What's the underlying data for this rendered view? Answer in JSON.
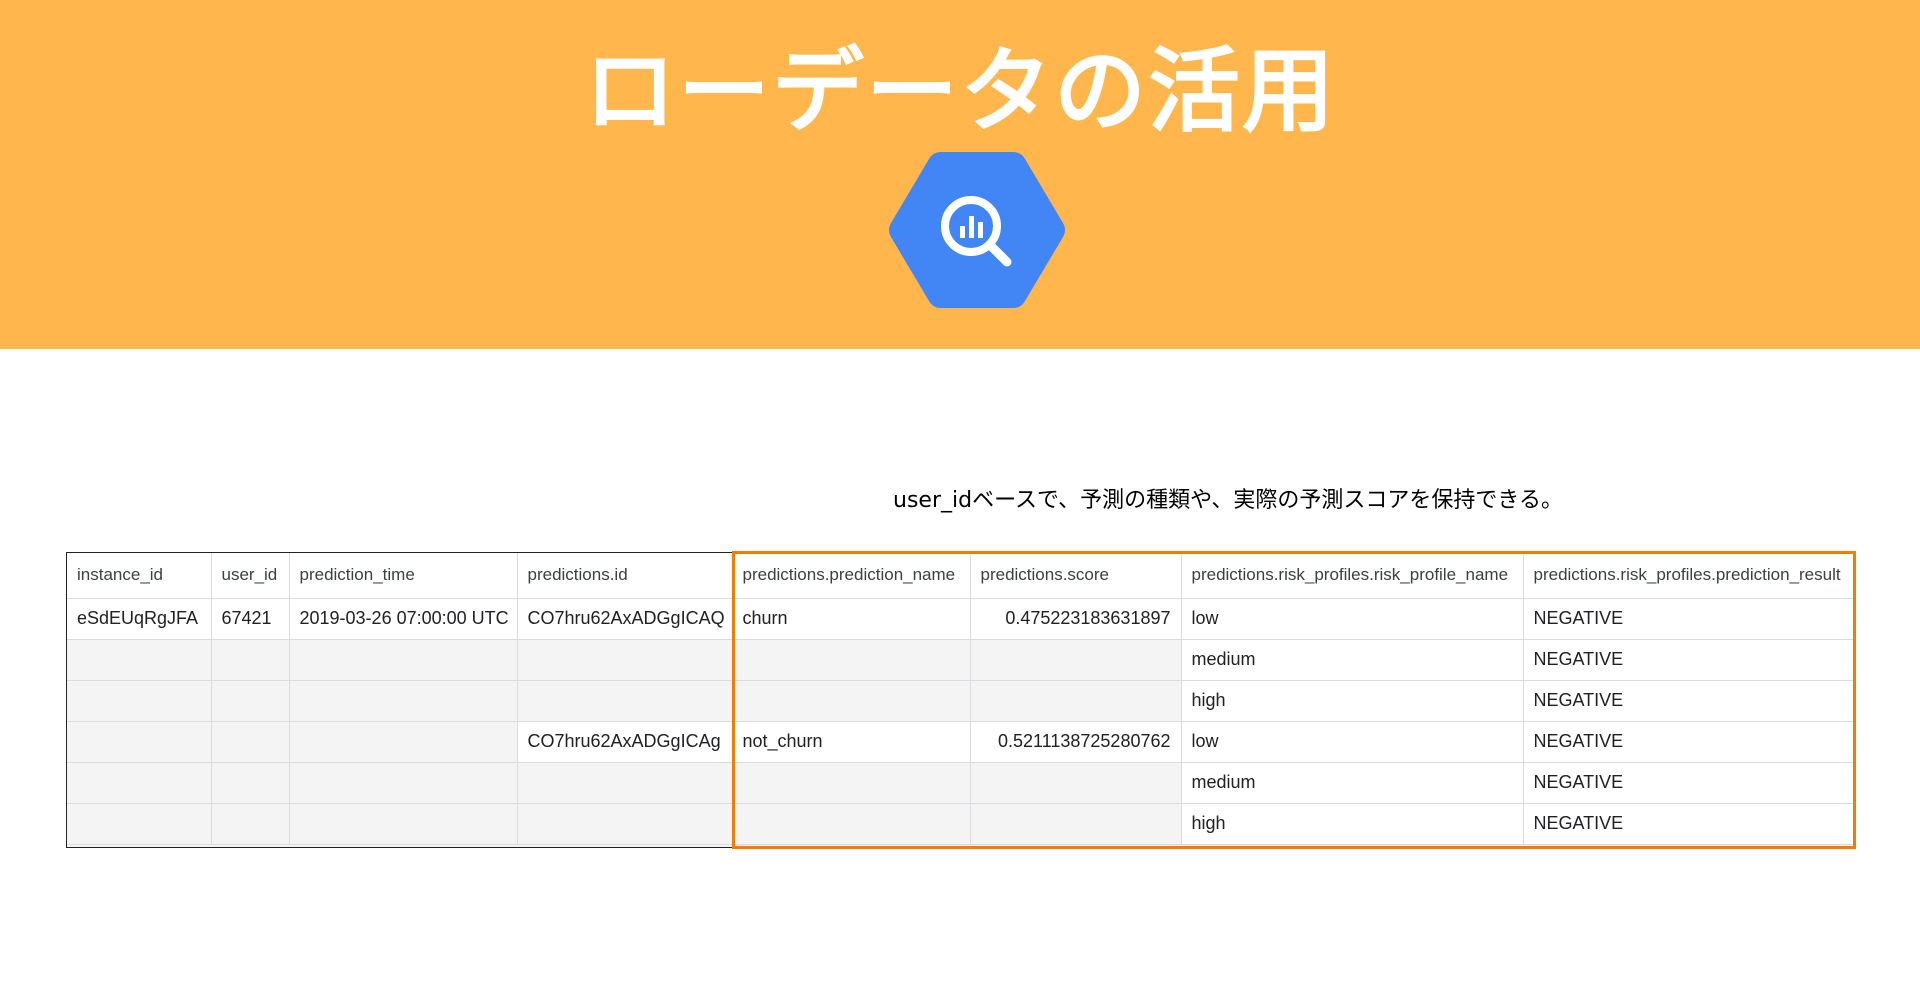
{
  "header": {
    "title": "ローデータの活用",
    "logo_icon": "bigquery-logo-icon",
    "banner_color": "#FFB74D",
    "logo_color": "#4285F4"
  },
  "caption": "user_idベースで、予測の種類や、実際の予測スコアを保持できる。",
  "highlight_color": "#F57C00",
  "table": {
    "columns": [
      "instance_id",
      "user_id",
      "prediction_time",
      "predictions.id",
      "predictions.prediction_name",
      "predictions.score",
      "predictions.risk_profiles.risk_profile_name",
      "predictions.risk_profiles.prediction_result"
    ],
    "rows": [
      [
        "eSdEUqRgJFA",
        "67421",
        "2019-03-26 07:00:00 UTC",
        "CO7hru62AxADGgICAQ",
        "churn",
        "0.475223183631897",
        "low",
        "NEGATIVE"
      ],
      [
        "",
        "",
        "",
        "",
        "",
        "",
        "medium",
        "NEGATIVE"
      ],
      [
        "",
        "",
        "",
        "",
        "",
        "",
        "high",
        "NEGATIVE"
      ],
      [
        "",
        "",
        "",
        "CO7hru62AxADGgICAg",
        "not_churn",
        "0.5211138725280762",
        "low",
        "NEGATIVE"
      ],
      [
        "",
        "",
        "",
        "",
        "",
        "",
        "medium",
        "NEGATIVE"
      ],
      [
        "",
        "",
        "",
        "",
        "",
        "",
        "high",
        "NEGATIVE"
      ]
    ]
  }
}
